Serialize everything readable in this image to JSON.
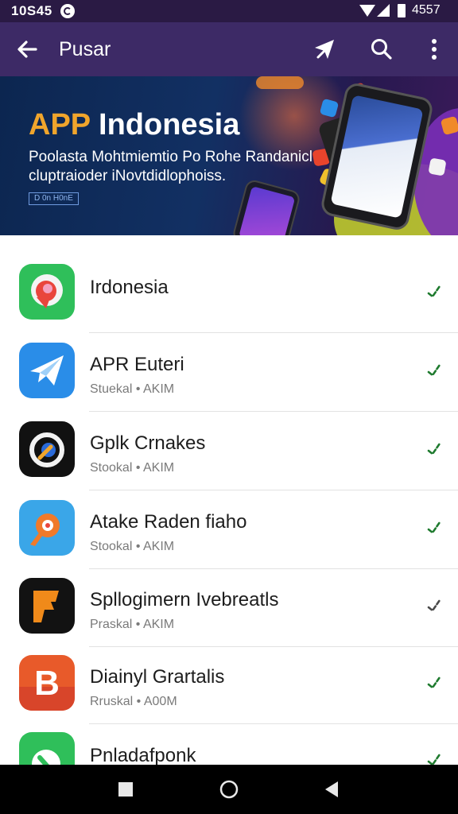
{
  "status_bar": {
    "time": "10S45",
    "battery_level": "4557"
  },
  "app_bar": {
    "title": "Pusar"
  },
  "banner": {
    "heading_accent": "APP",
    "heading_rest": " Indonesia",
    "subtitle": "Poolasta Mohtmiemtio Po Rohe Randanicl cluptraioder iNovtdidlophoiss.",
    "cta_label": "D 0n H0nE",
    "colors": {
      "accent": "#f0a52c",
      "background": "#0c2650"
    }
  },
  "apps": [
    {
      "name": "Irdonesia",
      "meta": "",
      "icon": "maps-pin-icon",
      "color": "#2fbf5a"
    },
    {
      "name": "APR Euteri",
      "meta": "Stuekal • AKIM",
      "icon": "paper-plane-icon",
      "color": "#2a8de8"
    },
    {
      "name": "Gplk Crnakes",
      "meta": "Stookal • AKIM",
      "icon": "lens-icon",
      "color": "#111111"
    },
    {
      "name": "Atake Raden fiaho",
      "meta": "Stookal • AKIM",
      "icon": "pencil-target-icon",
      "color": "#3aa6e8"
    },
    {
      "name": "Spllogimern Ivebreatls",
      "meta": "Praskal • AKIM",
      "icon": "letter-p-icon",
      "color": "#121212"
    },
    {
      "name": "Diainyl Grartalis",
      "meta": "Rruskal • A00M",
      "icon": "letter-b-icon",
      "color": "#e85a2a"
    },
    {
      "name": "Pnladafponk",
      "meta": "",
      "icon": "phone-icon",
      "color": "#2fbf5a"
    }
  ],
  "status_colors": {
    "installed": "#1e7a2e",
    "pending": "#4a4a4a"
  },
  "nav": {
    "recents": "square-icon",
    "home": "circle-icon",
    "back": "triangle-icon"
  }
}
